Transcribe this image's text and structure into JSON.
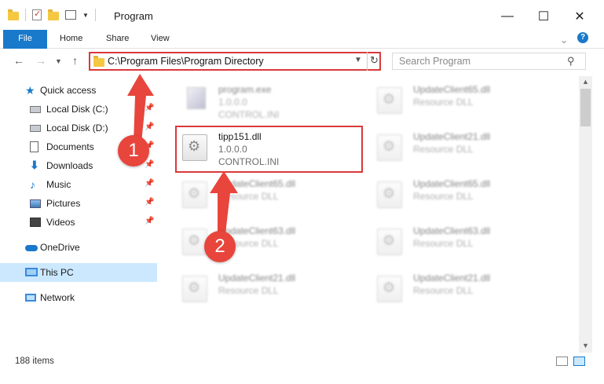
{
  "window": {
    "title": "Program",
    "controls": {
      "minimize": "—",
      "maximize": "☐",
      "close": "✕"
    }
  },
  "ribbon": {
    "tabs": [
      "File",
      "Home",
      "Share",
      "View"
    ],
    "help": "?"
  },
  "address": {
    "path": "C:\\Program Files\\Program Directory",
    "search_placeholder": "Search Program"
  },
  "sidebar": {
    "items": [
      {
        "label": "Quick access",
        "icon": "star-icon",
        "pinned": false
      },
      {
        "label": "Local Disk (C:)",
        "icon": "disk-icon",
        "pinned": true
      },
      {
        "label": "Local Disk (D:)",
        "icon": "disk-icon",
        "pinned": true
      },
      {
        "label": "Documents",
        "icon": "document-icon",
        "pinned": true
      },
      {
        "label": "Downloads",
        "icon": "download-icon",
        "pinned": true
      },
      {
        "label": "Music",
        "icon": "music-icon",
        "pinned": true
      },
      {
        "label": "Pictures",
        "icon": "picture-icon",
        "pinned": true
      },
      {
        "label": "Videos",
        "icon": "video-icon",
        "pinned": true
      },
      {
        "label": "OneDrive",
        "icon": "cloud-icon",
        "pinned": false
      },
      {
        "label": "This PC",
        "icon": "computer-icon",
        "pinned": false,
        "selected": true
      },
      {
        "label": "Network",
        "icon": "network-icon",
        "pinned": false
      }
    ]
  },
  "files": [
    {
      "name": "program.exe",
      "line2": "1.0.0.0",
      "line3": "CONTROL.INI",
      "blurred": true
    },
    {
      "name": "UpdateClient65.dll",
      "line2": "Resource DLL",
      "line3": "",
      "blurred": true
    },
    {
      "name": "tipp151.dll",
      "line2": "1.0.0.0",
      "line3": "CONTROL.INI",
      "blurred": false,
      "highlighted": true
    },
    {
      "name": "UpdateClient21.dll",
      "line2": "Resource DLL",
      "line3": "",
      "blurred": true
    },
    {
      "name": "UpdateClient65.dll",
      "line2": "Resource DLL",
      "line3": "",
      "blurred": true
    },
    {
      "name": "UpdateClient65.dll",
      "line2": "Resource DLL",
      "line3": "",
      "blurred": true
    },
    {
      "name": "UpdateClient63.dll",
      "line2": "Resource DLL",
      "line3": "",
      "blurred": true
    },
    {
      "name": "UpdateClient63.dll",
      "line2": "Resource DLL",
      "line3": "",
      "blurred": true
    },
    {
      "name": "UpdateClient21.dll",
      "line2": "Resource DLL",
      "line3": "",
      "blurred": true
    },
    {
      "name": "UpdateClient21.dll",
      "line2": "Resource DLL",
      "line3": "",
      "blurred": true
    }
  ],
  "status": {
    "item_count": "188 items"
  },
  "annotations": {
    "step1": "1",
    "step2": "2",
    "color": "#e8453c"
  },
  "colors": {
    "accent": "#1979ca",
    "highlight_border": "#d9393b",
    "selected_bg": "#cce8ff"
  }
}
